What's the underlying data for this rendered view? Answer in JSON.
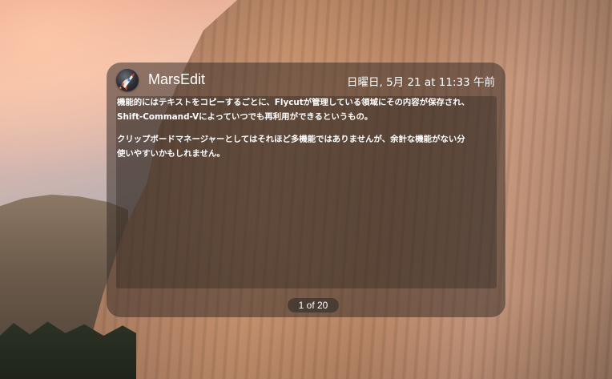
{
  "notification": {
    "app_name": "MarsEdit",
    "app_icon": "marsedit-rocket-icon",
    "timestamp": "日曜日, 5月 21 at 11:33 午前",
    "body": {
      "para1_line1": "機能的にはテキストをコピーするごとに、Flycutが管理している領域にその内容が保存され、",
      "para1_line2": "Shift-Command-Vによっていつでも再利用ができるというもの。",
      "para2_line1": "クリップボードマネージャーとしてはそれほど多機能ではありませんが、余計な機能がない分",
      "para2_line2": "使いやすいかもしれません。"
    },
    "pager": "1 of 20"
  },
  "colors": {
    "panel_bg": "#3a302a",
    "text": "#ffffff"
  }
}
